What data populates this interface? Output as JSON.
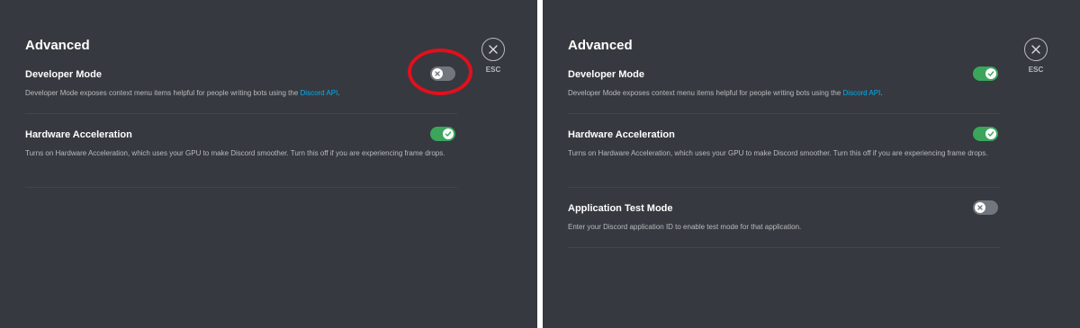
{
  "left_panel": {
    "section_title": "Advanced",
    "esc_label": "ESC",
    "developer_mode": {
      "title": "Developer Mode",
      "desc_prefix": "Developer Mode exposes context menu items helpful for people writing bots using the ",
      "link": "Discord API",
      "desc_suffix": ".",
      "enabled": false
    },
    "hardware_acceleration": {
      "title": "Hardware Acceleration",
      "desc": "Turns on Hardware Acceleration, which uses your GPU to make Discord smoother. Turn this off if you are experiencing frame drops.",
      "enabled": true
    }
  },
  "right_panel": {
    "section_title": "Advanced",
    "esc_label": "ESC",
    "developer_mode": {
      "title": "Developer Mode",
      "desc_prefix": "Developer Mode exposes context menu items helpful for people writing bots using the ",
      "link": "Discord API",
      "desc_suffix": ".",
      "enabled": true
    },
    "hardware_acceleration": {
      "title": "Hardware Acceleration",
      "desc": "Turns on Hardware Acceleration, which uses your GPU to make Discord smoother. Turn this off if you are experiencing frame drops.",
      "enabled": true
    },
    "application_test_mode": {
      "title": "Application Test Mode",
      "desc": "Enter your Discord application ID to enable test mode for that application.",
      "enabled": false
    }
  },
  "colors": {
    "background": "#36393f",
    "toggle_on": "#3ba55c",
    "toggle_off": "#72767d",
    "link": "#00b0f4",
    "highlight": "#e0101d"
  },
  "icons": {
    "close": "close-icon",
    "toggle_on": "check-icon",
    "toggle_off": "x-icon"
  }
}
